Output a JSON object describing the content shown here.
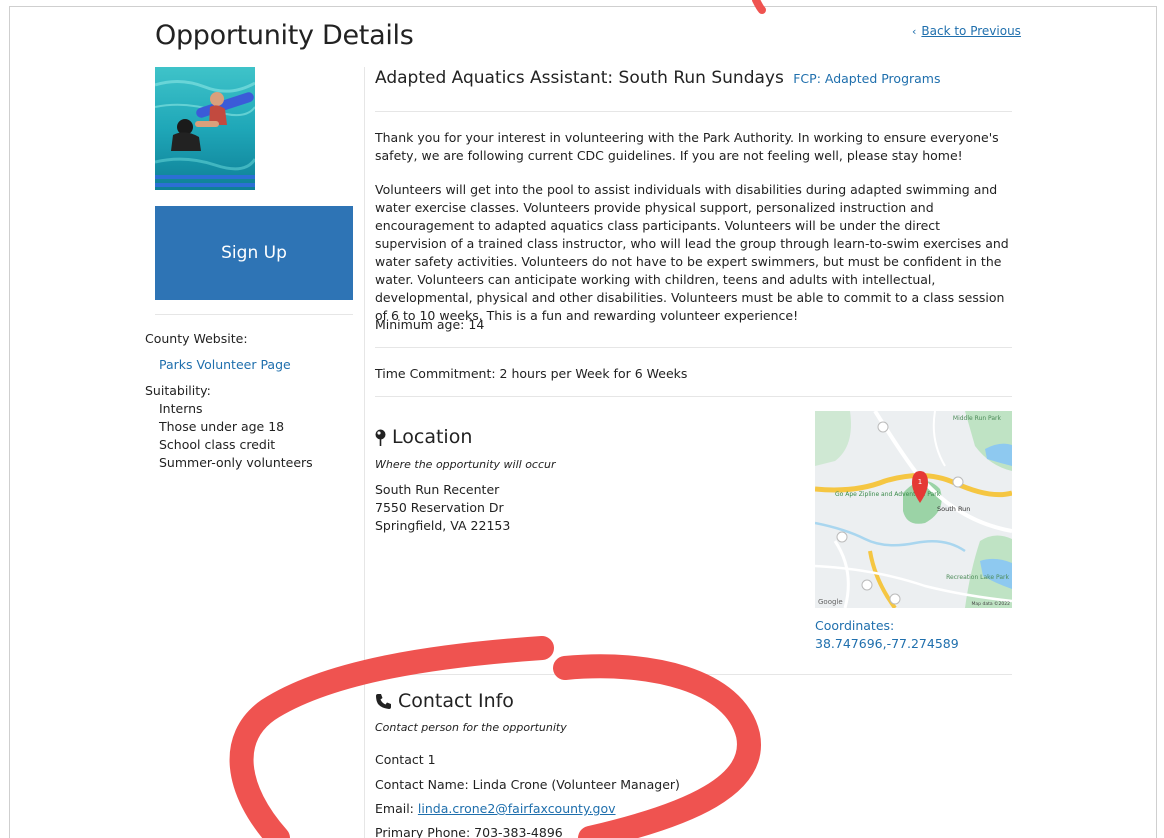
{
  "page": {
    "title": "Opportunity Details",
    "back_link": "Back to Previous"
  },
  "sidebar": {
    "signup_label": "Sign Up",
    "county_label": "County Website:",
    "county_link": "Parks Volunteer Page",
    "suitability_label": "Suitability:",
    "suitability": [
      "Interns",
      "Those under age 18",
      "School class credit",
      "Summer-only volunteers"
    ]
  },
  "opportunity": {
    "title": "Adapted Aquatics Assistant: South Run Sundays",
    "category": "FCP: Adapted Programs",
    "intro": "Thank you for your interest in volunteering with the Park Authority. In working to ensure everyone's safety, we are following current CDC guidelines. If you are not feeling well, please stay home!",
    "description": "Volunteers will get into the pool to assist individuals with disabilities during adapted swimming and water exercise classes. Volunteers provide physical support, personalized instruction and encouragement to adapted aquatics class participants. Volunteers will be under the direct supervision of a trained class instructor, who will lead the group through learn-to-swim exercises and water safety activities. Volunteers do not have to be expert swimmers, but must be confident in the water. Volunteers can anticipate working with children, teens and adults with intellectual, developmental, physical and other disabilities. Volunteers must be able to commit to a class session of 6 to 10 weeks. This is a fun and rewarding volunteer experience!",
    "min_age": "Minimum age: 14",
    "time_commitment": "Time Commitment: 2 hours per Week for 6 Weeks"
  },
  "location": {
    "heading": "Location",
    "subtitle": "Where the opportunity will occur",
    "address": [
      "South Run Recenter",
      "7550 Reservation Dr",
      "Springfield, VA 22153"
    ],
    "coords_label": "Coordinates:",
    "coords_value": "38.747696,-77.274589",
    "map_labels": {
      "middle_run": "Middle Run Park",
      "go_ape": "Go Ape Zipline and Adventure Park",
      "south_run": "South Run",
      "recreation": "Recreation Lake Park",
      "google": "Google",
      "map_data": "Map data ©2022",
      "marker": "1"
    }
  },
  "contact": {
    "heading": "Contact Info",
    "subtitle": "Contact person for the opportunity",
    "contact_num": "Contact 1",
    "name": "Contact Name: Linda Crone (Volunteer Manager)",
    "email_label": "Email:",
    "email": "linda.crone2@fairfaxcounty.gov",
    "phone": "Primary Phone: 703-383-4896"
  },
  "colors": {
    "link": "#1f6fad",
    "signup_bg": "#2e74b5",
    "annotation": "#ef5350"
  },
  "icons": [
    "chevron-left-icon",
    "map-pin-icon",
    "phone-icon"
  ]
}
